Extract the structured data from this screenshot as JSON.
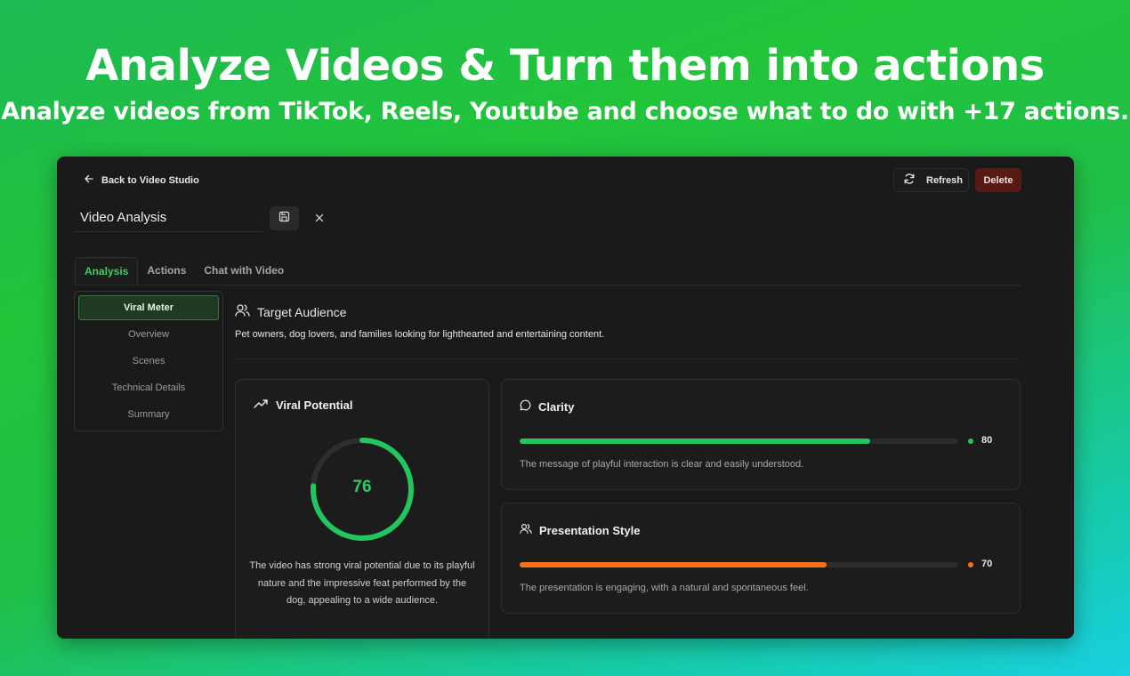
{
  "hero": {
    "title": "Analyze Videos & Turn them into actions",
    "subtitle": "Analyze videos from TikTok, Reels, Youtube and choose what to do with +17 actions."
  },
  "header": {
    "back_label": "Back to Video Studio",
    "refresh_label": "Refresh",
    "delete_label": "Delete",
    "title_value": "Video Analysis"
  },
  "tabs": [
    {
      "label": "Analysis",
      "active": true
    },
    {
      "label": "Actions",
      "active": false
    },
    {
      "label": "Chat with Video",
      "active": false
    }
  ],
  "sidebar": {
    "items": [
      {
        "label": "Viral Meter",
        "active": true
      },
      {
        "label": "Overview",
        "active": false
      },
      {
        "label": "Scenes",
        "active": false
      },
      {
        "label": "Technical Details",
        "active": false
      },
      {
        "label": "Summary",
        "active": false
      }
    ]
  },
  "target_audience": {
    "heading": "Target Audience",
    "text": "Pet owners, dog lovers, and families looking for lighthearted and entertaining content."
  },
  "viral_potential": {
    "heading": "Viral Potential",
    "score": 76,
    "score_label": "76",
    "description": "The video has strong viral potential due to its playful nature and the impressive feat performed by the dog, appealing to a wide audience."
  },
  "metrics": [
    {
      "name": "Clarity",
      "icon": "chat-bubble-icon",
      "value": 80,
      "value_label": "80",
      "color": "#22c55e",
      "description": "The message of playful interaction is clear and easily understood."
    },
    {
      "name": "Presentation Style",
      "icon": "users-icon",
      "value": 70,
      "value_label": "70",
      "color": "#f97316",
      "description": "The presentation is engaging, with a natural and spontaneous feel."
    }
  ],
  "colors": {
    "accent_green": "#22c55e",
    "accent_orange": "#f97316",
    "delete_bg": "#5a1a14"
  }
}
